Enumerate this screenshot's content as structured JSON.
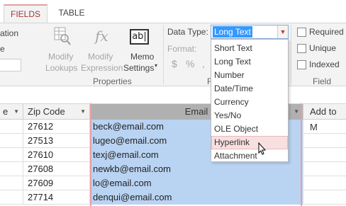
{
  "tabs": [
    {
      "label": "FIELDS"
    },
    {
      "label": "TABLE"
    }
  ],
  "ribbon": {
    "cut_labels": {
      "l1": "ation",
      "l2": "e"
    },
    "modify_lookups": {
      "line1": "Modify",
      "line2": "Lookups"
    },
    "modify_expression": {
      "line1": "Modify",
      "line2": "Expression"
    },
    "memo_settings": {
      "line1": "Memo",
      "line2": "Settings"
    },
    "fx_icon": "fx",
    "ab_icon": "ab|",
    "properties_label": "Properties",
    "data_type_label": "Data Type:",
    "data_type_value": "Long Text",
    "format_label": "Format:",
    "format_symbols": [
      "$",
      "%",
      ","
    ],
    "f_cut": "F",
    "required_label": "Required",
    "unique_label": "Unique",
    "indexed_label": "Indexed",
    "field_validation_label": "Field Valid"
  },
  "dropdown": {
    "options": [
      "Short Text",
      "Long Text",
      "Number",
      "Date/Time",
      "Currency",
      "Yes/No",
      "OLE Object",
      "Hyperlink",
      "Attachment"
    ],
    "highlighted": "Hyperlink"
  },
  "grid": {
    "columns": [
      {
        "label": "e"
      },
      {
        "label": "Zip Code"
      },
      {
        "label": "Email"
      },
      {
        "label": "Add to M"
      }
    ],
    "rows": [
      {
        "zip": "27612",
        "email": "beck@email.com"
      },
      {
        "zip": "27513",
        "email": "lugeo@email.com"
      },
      {
        "zip": "27610",
        "email": "texj@email.com"
      },
      {
        "zip": "27608",
        "email": "newkb@email.com"
      },
      {
        "zip": "27609",
        "email": "lo@email.com"
      },
      {
        "zip": "27714",
        "email": "denqui@email.com"
      }
    ]
  },
  "colors": {
    "accent": "#a4373a",
    "selection": "#b9d3f3",
    "highlight": "#f8dfe0"
  }
}
